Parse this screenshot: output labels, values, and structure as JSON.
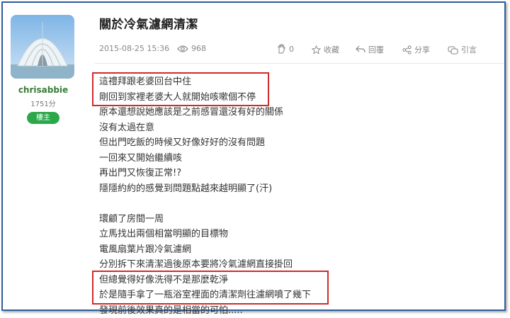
{
  "author": {
    "username": "chrisabbie",
    "points": "1751分",
    "badge": "樓主"
  },
  "post": {
    "title": "關於冷氣濾網清潔",
    "timestamp": "2015-08-25 15:36",
    "views": "968",
    "likes": "0",
    "actions": {
      "collect": "收藏",
      "reply": "回覆",
      "share": "分享",
      "quote": "引言"
    },
    "body_group1": [
      "這禮拜跟老婆回台中住",
      "剛回到家裡老婆大人就開始咳嗽個不停",
      "原本還想說她應該是之前感冒還沒有好的關係",
      "沒有太過在意",
      "但出門吃飯的時候又好像好好的沒有問題",
      "一回來又開始繼續咳",
      "再出門又恢復正常!?",
      "隱隱約約的感覺到問題點越來越明顯了(汗)"
    ],
    "body_group2": [
      "環顧了房間一周",
      "立馬找出兩個相當明顯的目標物",
      "電風扇葉片跟冷氣濾網",
      "分別拆下來清潔過後原本要將冷氣濾網直接掛回",
      "但總覺得好像洗得不是那麼乾淨",
      "於是隨手拿了一瓶浴室裡面的清潔劑往濾網噴了幾下",
      "發現前後效果真的是相當的可怕....."
    ]
  },
  "colors": {
    "highlight": "#d12b2b",
    "badge": "#2aa84a",
    "username": "#3b7d3b",
    "frame": "#2f5f9e"
  }
}
